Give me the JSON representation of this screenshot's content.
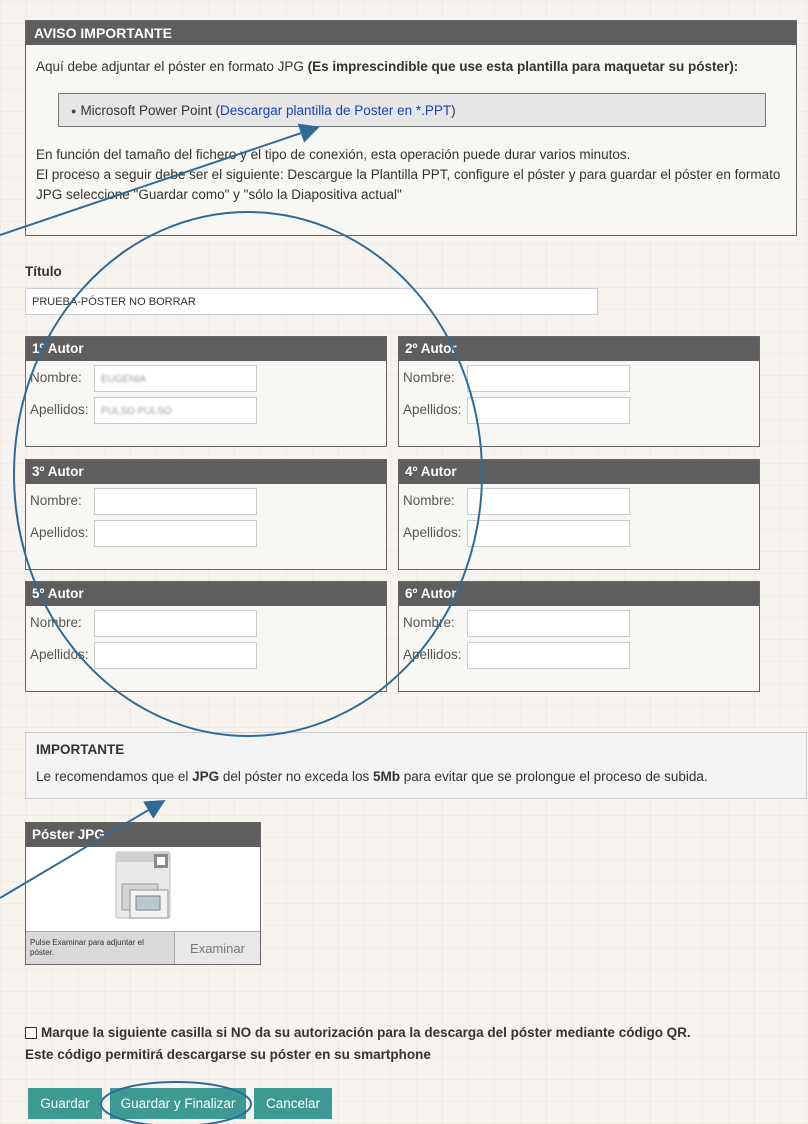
{
  "notice": {
    "header": "AVISO IMPORTANTE",
    "intro_text": "Aquí debe adjuntar el póster en formato JPG ",
    "intro_bold": "(Es imprescindible que use esta plantilla para maquetar su póster):",
    "template_prefix": "Microsoft Power Point (",
    "template_link": "Descargar plantilla de Poster en *.PPT",
    "template_suffix": ")",
    "line1": "En función del tamaño del fichero y el tipo de conexión, esta operación puede durar varios minutos.",
    "line2": "El proceso a seguir debe ser el siguiente: Descargue la Plantilla PPT, configure el póster y para guardar el póster en formato JPG seleccione \"Guardar como\" y \"sólo la Diapositiva actual\""
  },
  "title_field": {
    "label": "Título",
    "value": "PRUEBA-PÓSTER NO BORRAR"
  },
  "authors": [
    {
      "header": "1º Autor",
      "nombre_label": "Nombre:",
      "apellidos_label": "Apellidos:",
      "nombre": "EUGENIA",
      "apellidos": "PULSO PULSO"
    },
    {
      "header": "2º Autor",
      "nombre_label": "Nombre:",
      "apellidos_label": "Apellidos:",
      "nombre": "",
      "apellidos": ""
    },
    {
      "header": "3º Autor",
      "nombre_label": "Nombre:",
      "apellidos_label": "Apellidos:",
      "nombre": "",
      "apellidos": ""
    },
    {
      "header": "4º Autor",
      "nombre_label": "Nombre:",
      "apellidos_label": "Apellidos:",
      "nombre": "",
      "apellidos": ""
    },
    {
      "header": "5º Autor",
      "nombre_label": "Nombre:",
      "apellidos_label": "Apellidos:",
      "nombre": "",
      "apellidos": ""
    },
    {
      "header": "6º Autor",
      "nombre_label": "Nombre:",
      "apellidos_label": "Apellidos:",
      "nombre": "",
      "apellidos": ""
    }
  ],
  "importante": {
    "header": "IMPORTANTE",
    "text_a": "Le recomendamos que el ",
    "text_b": "JPG",
    "text_c": " del póster no exceda los ",
    "text_d": "5Mb",
    "text_e": " para evitar que se prolongue el proceso de subida."
  },
  "poster": {
    "header": "Póster JPG",
    "help": "Pulse Examinar para adjuntar el póster.",
    "browse_label": "Examinar"
  },
  "qr": {
    "line1": "Marque la siguiente casilla si NO da su autorización para la descarga del póster mediante código QR.",
    "line2": "Este código permitirá descargarse su póster en su smartphone"
  },
  "buttons": {
    "save": "Guardar",
    "save_finish": "Guardar y Finalizar",
    "cancel": "Cancelar"
  },
  "colors": {
    "header_bg": "#5e5e5e",
    "button_bg": "#3d9a93",
    "link": "#1a3fb6",
    "annotation": "#2f6b9a"
  },
  "icons": {
    "upload_preview": "upload-document-icon"
  }
}
